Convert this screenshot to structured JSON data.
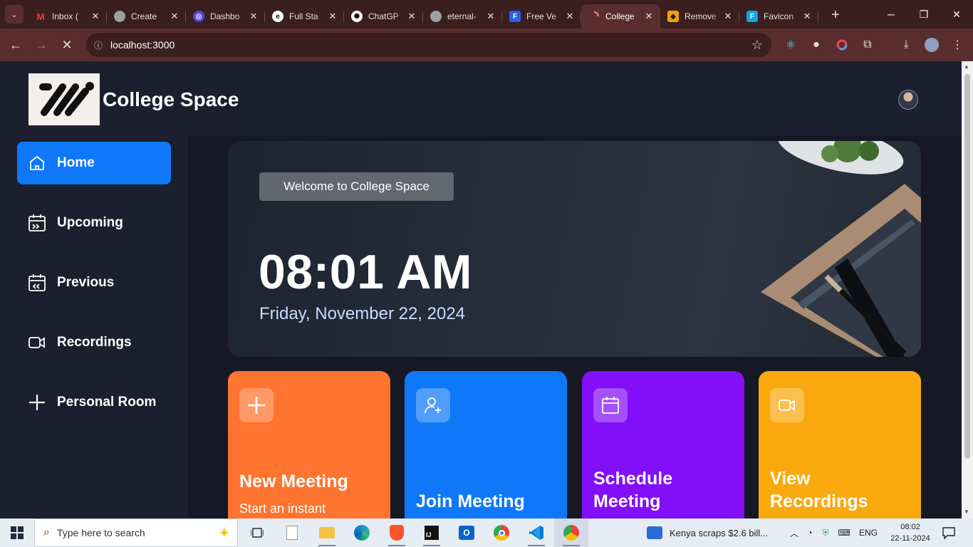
{
  "browser": {
    "tabs": [
      {
        "title": "Inbox (",
        "fav": "M",
        "fav_color": "#ea4335"
      },
      {
        "title": "Create",
        "fav": "",
        "fav_color": "#9aa0a6"
      },
      {
        "title": "Dashbo",
        "fav": "◎",
        "fav_color": "#4f46e5"
      },
      {
        "title": "Full Sta",
        "fav": "e",
        "fav_color": "#111111"
      },
      {
        "title": "ChatGP",
        "fav": "✺",
        "fav_color": "#111111"
      },
      {
        "title": "eternal-",
        "fav": "",
        "fav_color": "#9aa0a6"
      },
      {
        "title": "Free Ve",
        "fav": "F",
        "fav_color": "#2563eb"
      },
      {
        "title": "College",
        "fav": "",
        "fav_color": "transparent"
      },
      {
        "title": "Remove",
        "fav": "◆",
        "fav_color": "#f59e0b"
      },
      {
        "title": "Favicon",
        "fav": "F",
        "fav_color": "#0ea5e9"
      }
    ],
    "url": "localhost:3000"
  },
  "app": {
    "brand": "College Space",
    "nav": [
      {
        "label": "Home",
        "icon": "home-icon",
        "active": true
      },
      {
        "label": "Upcoming",
        "icon": "calendar-upcoming-icon",
        "active": false
      },
      {
        "label": "Previous",
        "icon": "calendar-previous-icon",
        "active": false
      },
      {
        "label": "Recordings",
        "icon": "video-icon",
        "active": false
      },
      {
        "label": "Personal Room",
        "icon": "plus-icon",
        "active": false
      }
    ],
    "hero": {
      "welcome": "Welcome to College Space",
      "time": "08:01 AM",
      "date": "Friday, November 22, 2024"
    },
    "cards": [
      {
        "title": "New Meeting",
        "subtitle": "Start an instant",
        "color": "#ff742e",
        "icon": "plus-icon"
      },
      {
        "title": "Join Meeting",
        "subtitle": "",
        "color": "#0e78f9",
        "icon": "add-user-icon"
      },
      {
        "title": "Schedule Meeting",
        "subtitle": "",
        "color": "#830ef9",
        "icon": "calendar-icon"
      },
      {
        "title": "View Recordings",
        "subtitle": "",
        "color": "#f9a90e",
        "icon": "video-icon"
      }
    ]
  },
  "taskbar": {
    "search_placeholder": "Type here to search",
    "news": "Kenya scraps $2.6 bill...",
    "lang": "ENG",
    "time": "08:02",
    "date": "22-11-2024"
  }
}
